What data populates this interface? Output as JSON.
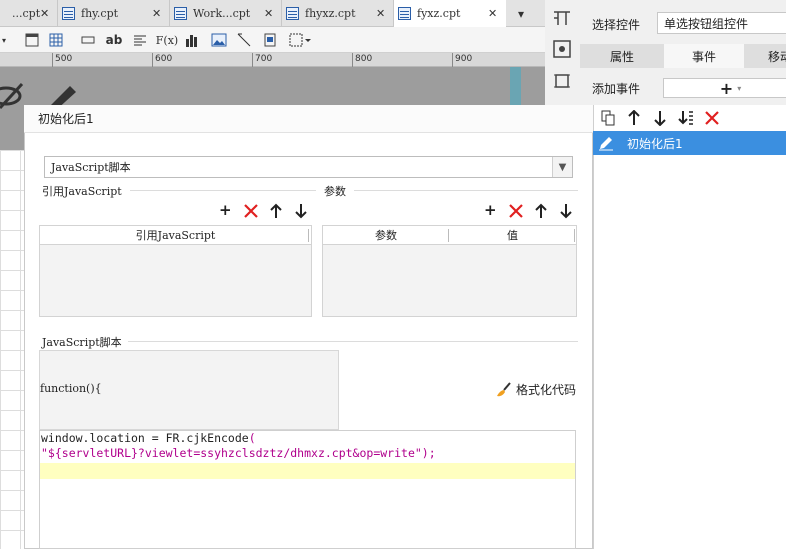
{
  "tabs": [
    {
      "label": "...cpt",
      "active": false
    },
    {
      "label": "fhy.cpt",
      "active": false
    },
    {
      "label": "Work...cpt",
      "active": false
    },
    {
      "label": "fhyxz.cpt",
      "active": false
    },
    {
      "label": "fyxz.cpt",
      "active": true
    }
  ],
  "tab_close": "✕",
  "ruler": {
    "labels": [
      "500",
      "600",
      "700",
      "800",
      "900"
    ]
  },
  "toolbar": {
    "text_bold": "ab",
    "formula": "F(x)"
  },
  "right_panel": {
    "select_widget_label": "选择控件",
    "select_widget_value": "单选按钮组控件",
    "tabs": [
      "属性",
      "事件",
      "移动"
    ],
    "add_event_label": "添加事件",
    "add_symbol": "+",
    "events": [
      "初始化后1"
    ]
  },
  "dialog": {
    "title": "初始化后1",
    "script_type": "JavaScript脚本",
    "ref_js_section": "引用JavaScript",
    "params_section": "参数",
    "ref_js_column": "引用JavaScript",
    "param_columns": [
      "参数",
      "值"
    ],
    "script_section": "JavaScript脚本",
    "function_header": "function(){",
    "format_code": "格式化代码",
    "code_lines": [
      {
        "text": "window.location = FR.cjkEncode(",
        "color": "#222222"
      },
      {
        "text": "\"${servletURL}?viewlet=ssyhzclsdztz/dhmxz.cpt&op=write\");",
        "color": "#b0008c"
      }
    ]
  },
  "colors": {
    "accent": "#3b8fe0",
    "delete": "#e02020",
    "highlight": "#ffffc0"
  }
}
